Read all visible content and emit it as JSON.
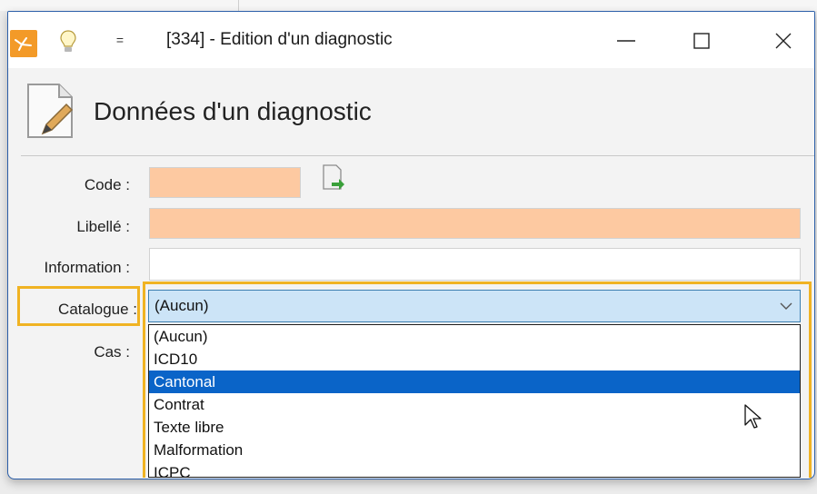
{
  "window": {
    "title": "[334] -  Edition d'un diagnostic",
    "quick_access": "="
  },
  "header": {
    "title": "Données d'un diagnostic"
  },
  "form": {
    "code_label": "Code :",
    "code_value": "",
    "libelle_label": "Libellé :",
    "libelle_value": "",
    "information_label": "Information :",
    "information_value": "",
    "catalogue_label": "Catalogue :",
    "catalogue_value": "(Aucun)",
    "cas_label": "Cas :"
  },
  "dropdown": {
    "selected": "Cantonal",
    "options": [
      "(Aucun)",
      "ICD10",
      "Cantonal",
      "Contrat",
      "Texte libre",
      "Malformation",
      "ICPC"
    ]
  },
  "colors": {
    "accent": "#f0b323",
    "required_field": "#fdc9a1",
    "selection": "#0a64c8",
    "combo_background": "#cce4f7",
    "app_icon": "#f39a28"
  },
  "icons": [
    "app-icon",
    "lightbulb-icon",
    "quick-access-icon",
    "minimize-icon",
    "maximize-icon",
    "close-icon",
    "document-edit-icon",
    "generate-code-icon",
    "chevron-down-icon",
    "mouse-cursor-icon"
  ]
}
